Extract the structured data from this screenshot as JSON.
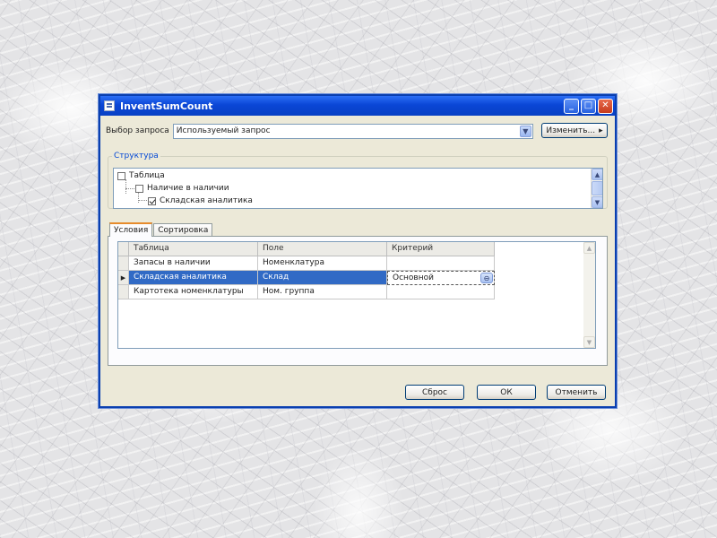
{
  "window": {
    "title": "InventSumCount",
    "controls": {
      "minimize": "_",
      "maximize": "□",
      "close": "✕"
    }
  },
  "query": {
    "label": "Выбор запроса",
    "value": "Используемый запрос",
    "change_button": "Изменить...",
    "change_arrow": "▸"
  },
  "structure": {
    "legend": "Структура",
    "items": [
      {
        "label": "Таблица",
        "checked": false
      },
      {
        "label": "Наличие в наличии",
        "checked": false
      },
      {
        "label": "Складская аналитика",
        "checked": true
      }
    ]
  },
  "tabs": [
    {
      "label": "Условия",
      "active": true
    },
    {
      "label": "Сортировка",
      "active": false
    }
  ],
  "grid": {
    "headers": [
      "Таблица",
      "Поле",
      "Критерий"
    ],
    "rows": [
      {
        "marker": "",
        "table": "Запасы в наличии",
        "field": "Номенклатура",
        "criterion": ""
      },
      {
        "marker": "▶",
        "table": "Складская аналитика",
        "field": "Склад",
        "criterion": "Основной",
        "selected": true
      },
      {
        "marker": "",
        "table": "Картотека номенклатуры",
        "field": "Ном. группа",
        "criterion": ""
      }
    ]
  },
  "buttons": {
    "reset": "Сброс",
    "ok": "ОК",
    "cancel": "Отменить"
  },
  "icons": {
    "combo_arrow": "▼",
    "scroll_up": "▲",
    "scroll_down": "▼",
    "lookup": "⊖"
  },
  "colors": {
    "titlebar": "#0a46d6",
    "selection": "#316ac5",
    "legend": "#0046d5",
    "active_tab_accent": "#e68b2c"
  }
}
